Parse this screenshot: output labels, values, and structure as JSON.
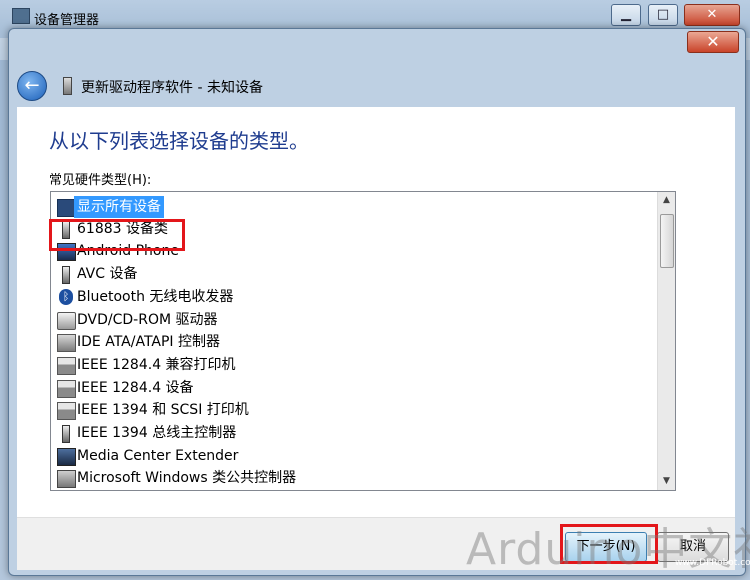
{
  "outer_window": {
    "title": "设备管理器",
    "minimize": "▁",
    "maximize": "□",
    "close": "✕"
  },
  "dialog": {
    "close": "✕",
    "back_icon": "back-arrow-icon",
    "header_title": "更新驱动程序软件 - 未知设备",
    "heading": "从以下列表选择设备的类型。",
    "list_label": "常见硬件类型(H):",
    "items": [
      {
        "label": "显示所有设备",
        "icon": "all-devices-icon",
        "selected": true
      },
      {
        "label": "61883 设备类",
        "icon": "usb-plug-icon"
      },
      {
        "label": "Android Phone",
        "icon": "phone-icon"
      },
      {
        "label": "AVC 设备",
        "icon": "usb-plug-icon"
      },
      {
        "label": "Bluetooth 无线电收发器",
        "icon": "bluetooth-icon"
      },
      {
        "label": "DVD/CD-ROM 驱动器",
        "icon": "dvd-drive-icon"
      },
      {
        "label": "IDE ATA/ATAPI 控制器",
        "icon": "ide-controller-icon"
      },
      {
        "label": "IEEE 1284.4 兼容打印机",
        "icon": "printer-icon"
      },
      {
        "label": "IEEE 1284.4 设备",
        "icon": "printer-icon"
      },
      {
        "label": "IEEE 1394 和 SCSI 打印机",
        "icon": "printer-icon"
      },
      {
        "label": "IEEE 1394 总线主控制器",
        "icon": "usb-plug-icon"
      },
      {
        "label": "Media Center Extender",
        "icon": "monitor-icon"
      },
      {
        "label": "Microsoft Windows 类公共控制器",
        "icon": "controller-icon"
      }
    ],
    "footer": {
      "next_label": "下一步(N)",
      "cancel_label": "取消"
    }
  },
  "watermark": {
    "text": "Arduino中文社区",
    "url_text": "www.DFRobot.com.cn"
  },
  "colors": {
    "heading": "#1f3c8f",
    "selection": "#3399ff",
    "highlight_box": "#e3161a"
  }
}
